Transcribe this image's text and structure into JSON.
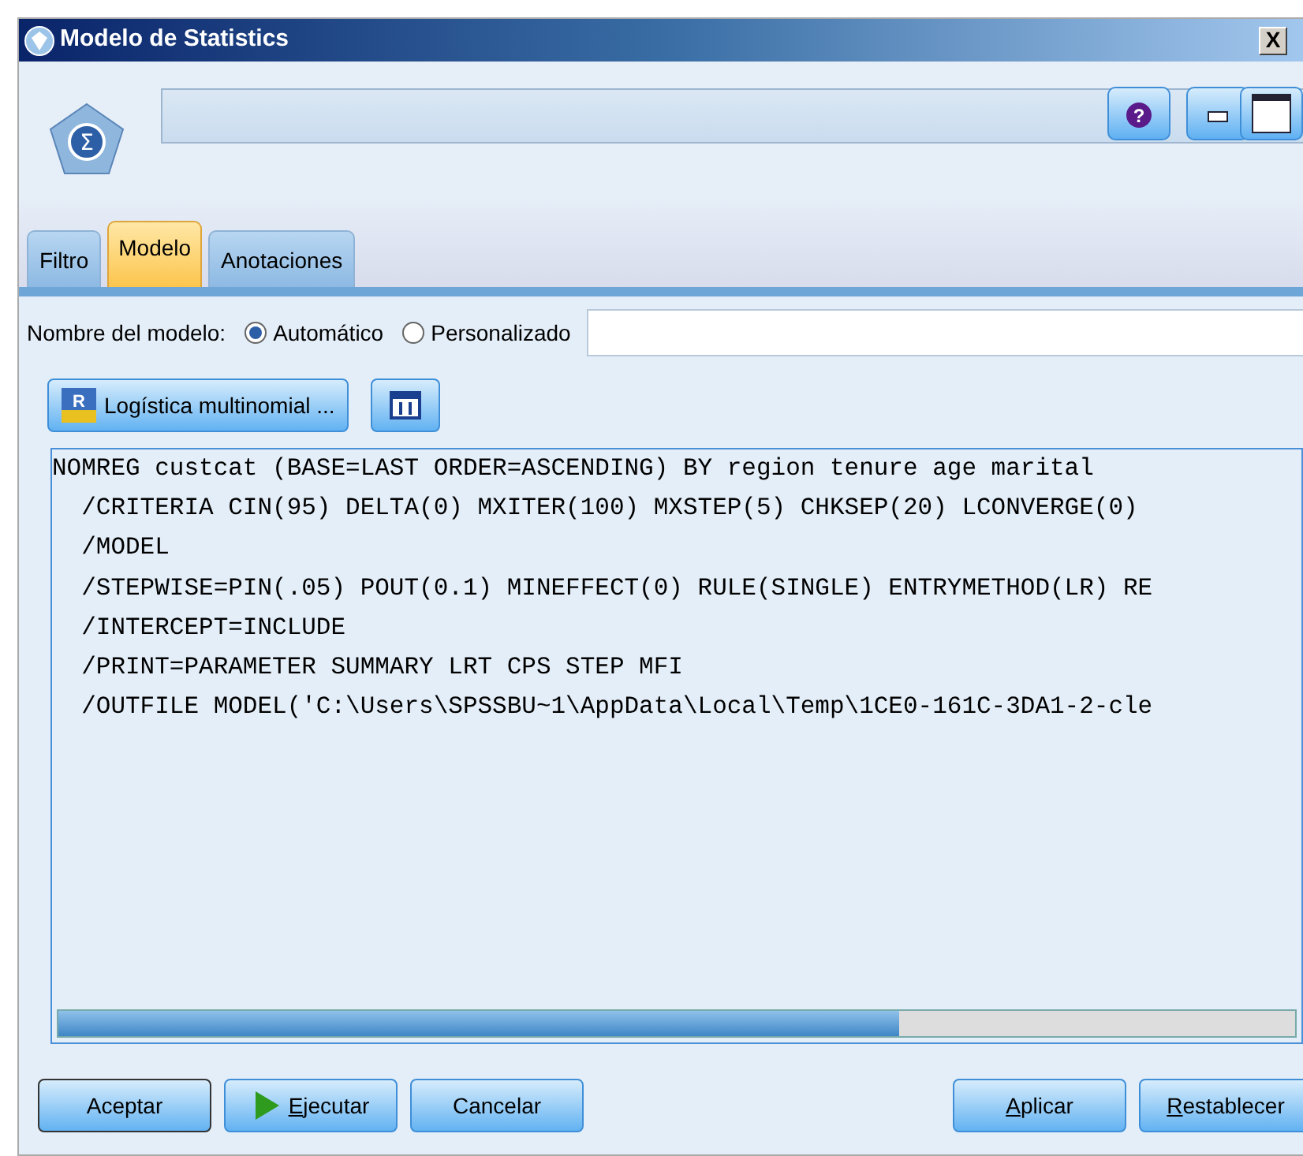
{
  "window": {
    "title": "Modelo de Statistics",
    "close_glyph": "X"
  },
  "node_icon": {
    "glyph": "Σ"
  },
  "help_button": {
    "glyph": "?"
  },
  "tabs": [
    {
      "label": "Filtro",
      "selected": false
    },
    {
      "label": "Modelo",
      "selected": true
    },
    {
      "label": "Anotaciones",
      "selected": false
    }
  ],
  "model_name": {
    "label": "Nombre del modelo:",
    "options": [
      {
        "label": "Automático",
        "selected": true
      },
      {
        "label": "Personalizado",
        "selected": false
      }
    ]
  },
  "procedure_button": {
    "label": "Logística multinomial ...",
    "icon_glyph": "R"
  },
  "syntax_lines": [
    "NOMREG custcat (BASE=LAST ORDER=ASCENDING) BY region tenure age marital",
    "  /CRITERIA CIN(95) DELTA(0) MXITER(100) MXSTEP(5) CHKSEP(20) LCONVERGE(0)",
    "  /MODEL",
    "  /STEPWISE=PIN(.05) POUT(0.1) MINEFFECT(0) RULE(SINGLE) ENTRYMETHOD(LR) RE",
    "  /INTERCEPT=INCLUDE",
    "  /PRINT=PARAMETER SUMMARY LRT CPS STEP MFI",
    "  /OUTFILE MODEL('C:\\Users\\SPSSBU~1\\AppData\\Local\\Temp\\1CE0-161C-3DA1-2-cle"
  ],
  "buttons": [
    {
      "label": "Aceptar",
      "kind": "default",
      "underline_first": false
    },
    {
      "label": "Ejecutar",
      "kind": "run",
      "underline_first": true
    },
    {
      "label": "Cancelar",
      "kind": "plain",
      "underline_first": false
    },
    {
      "label": "Aplicar",
      "kind": "right",
      "underline_first": true
    },
    {
      "label": "Restablecer",
      "kind": "right",
      "underline_first": true
    }
  ]
}
